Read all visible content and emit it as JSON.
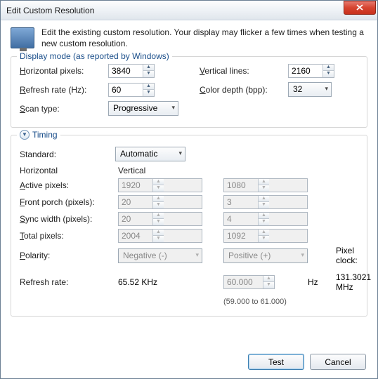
{
  "title": "Edit Custom Resolution",
  "intro": "Edit the existing custom resolution. Your display may flicker a few times when testing a new custom resolution.",
  "group1_label": "Display mode (as reported by Windows)",
  "labels": {
    "hpixels": "Horizontal pixels:",
    "vlines": "Vertical lines:",
    "refresh": "Refresh rate (Hz):",
    "colordepth": "Color depth (bpp):",
    "scantype": "Scan type:"
  },
  "values": {
    "hpixels": "3840",
    "vlines": "2160",
    "refresh": "60",
    "colordepth": "32",
    "scantype": "Progressive"
  },
  "timing_label": "Timing",
  "standard_label": "Standard:",
  "standard_value": "Automatic",
  "col_h": "Horizontal",
  "col_v": "Vertical",
  "trow": {
    "active": "Active pixels:",
    "front": "Front porch (pixels):",
    "sync": "Sync width (pixels):",
    "total": "Total pixels:",
    "polarity": "Polarity:",
    "refresh": "Refresh rate:"
  },
  "tval": {
    "active_h": "1920",
    "active_v": "1080",
    "front_h": "20",
    "front_v": "3",
    "sync_h": "20",
    "sync_v": "4",
    "total_h": "2004",
    "total_v": "1092",
    "pol_h": "Negative (-)",
    "pol_v": "Positive (+)",
    "refresh_h": "65.52 KHz",
    "refresh_v": "60.000"
  },
  "hz": "Hz",
  "range": "(59.000 to 61.000)",
  "pixelclock_label": "Pixel clock:",
  "pixelclock_value": "131.3021 MHz",
  "buttons": {
    "test": "Test",
    "cancel": "Cancel"
  }
}
